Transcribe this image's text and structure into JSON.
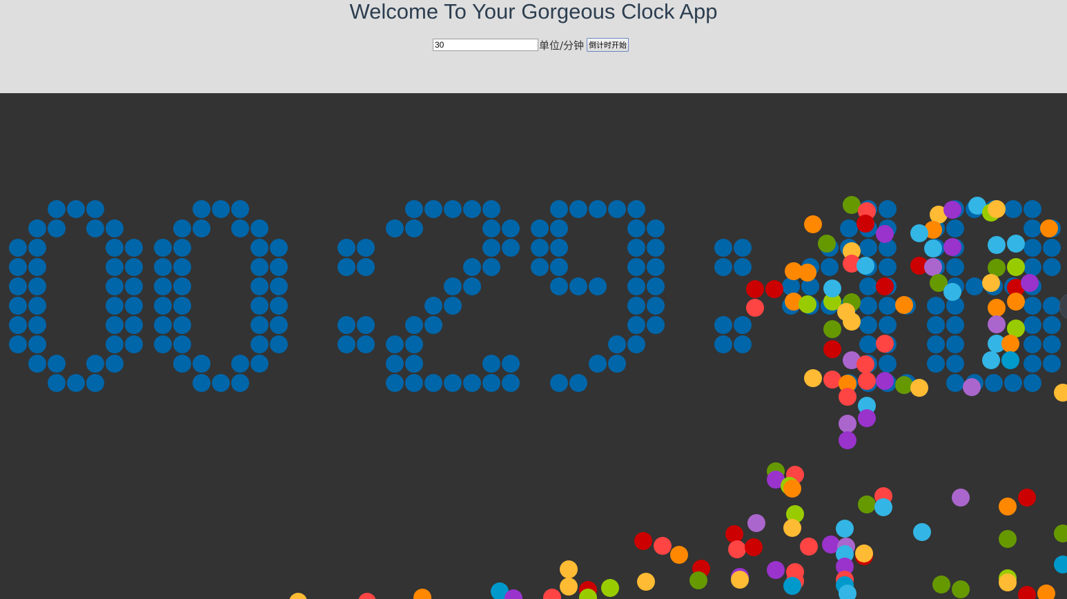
{
  "header": {
    "title": "Welcome To Your Gorgeous Clock App",
    "minutes_input": {
      "value": "30",
      "placeholder": ""
    },
    "unit_label": "单位/分钟",
    "start_button_label": "倒计时开始"
  },
  "clock": {
    "display_time": "00:29:48",
    "digit_color": "#0066aa",
    "background_color": "#333333",
    "header_background": "#dedede",
    "ball_colors": [
      "#33b5e5",
      "#0099cc",
      "#aa66cc",
      "#9933cc",
      "#99cc00",
      "#669900",
      "#ffbb33",
      "#ff8800",
      "#ff4444",
      "#cc0000"
    ]
  }
}
